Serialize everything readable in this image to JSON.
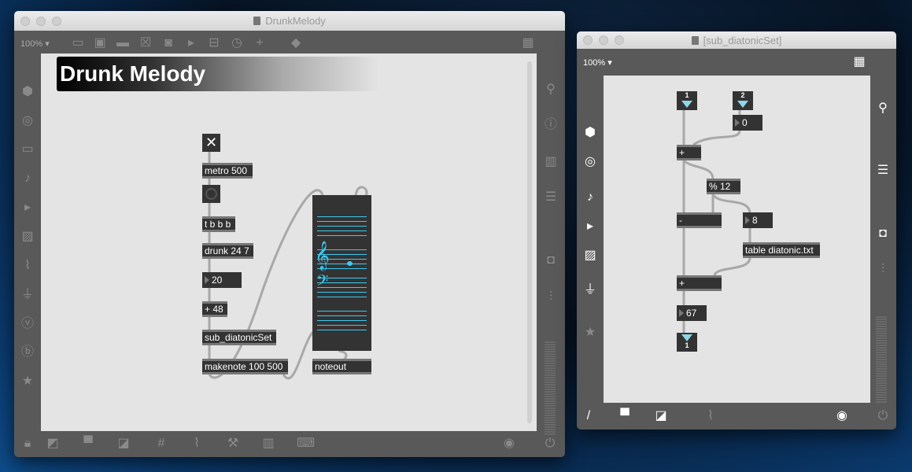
{
  "left_window": {
    "title": "DrunkMelody",
    "zoom": "100% ▾",
    "comment": "Drunk Melody",
    "objects": {
      "metro": "metro 500",
      "trigger": "t b b b",
      "drunk": "drunk 24 7",
      "number": "20",
      "add": "+ 48",
      "sub": "sub_diatonicSet",
      "makenote": "makenote 100 500",
      "noteout": "noteout"
    },
    "toggle_glyph": "✕"
  },
  "right_window": {
    "title": "[sub_diatonicSet]",
    "zoom": "100% ▾",
    "objects": {
      "inlet1": "1",
      "inlet2": "2",
      "num0": "0",
      "plus1": "+",
      "mod": "% 12",
      "minus": "-",
      "num8": "8",
      "table": "table diatonic.txt",
      "plus2": "+",
      "num67": "67",
      "outlet1": "1"
    }
  },
  "colors": {
    "cord": "#a8a8a8",
    "nslider_lines": "#3ec8f0",
    "object_bg": "#333333",
    "canvas": "#e4e4e4"
  }
}
